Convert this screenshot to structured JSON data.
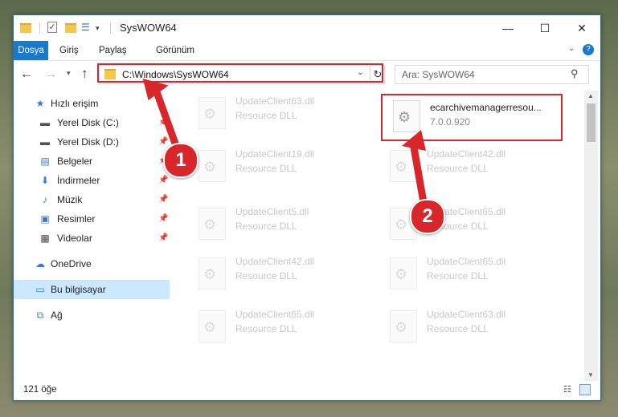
{
  "window": {
    "title": "SysWOW64",
    "controls": {
      "minimize": "—",
      "maximize": "☐",
      "close": "✕"
    }
  },
  "ribbon": {
    "tabs": [
      {
        "label": "Dosya"
      },
      {
        "label": "Giriş"
      },
      {
        "label": "Paylaş"
      },
      {
        "label": "Görünüm"
      }
    ],
    "help": "?"
  },
  "nav": {
    "address": "C:\\Windows\\SysWOW64",
    "search_placeholder": "Ara: SysWOW64"
  },
  "sidebar": {
    "items": [
      {
        "label": "Hızlı erişim",
        "icon": "star-icon",
        "pinned": false
      },
      {
        "label": "Yerel Disk (C:)",
        "icon": "disk-icon",
        "pinned": true
      },
      {
        "label": "Yerel Disk (D:)",
        "icon": "disk-icon",
        "pinned": true
      },
      {
        "label": "Belgeler",
        "icon": "documents-icon",
        "pinned": true
      },
      {
        "label": "İndirmeler",
        "icon": "download-icon",
        "pinned": true
      },
      {
        "label": "Müzik",
        "icon": "music-icon",
        "pinned": true
      },
      {
        "label": "Resimler",
        "icon": "pictures-icon",
        "pinned": true
      },
      {
        "label": "Videolar",
        "icon": "video-icon",
        "pinned": true
      },
      {
        "label": "OneDrive",
        "icon": "cloud-icon",
        "pinned": false
      },
      {
        "label": "Bu bilgisayar",
        "icon": "computer-icon",
        "pinned": false,
        "selected": true
      },
      {
        "label": "Ağ",
        "icon": "network-icon",
        "pinned": false
      }
    ]
  },
  "files": [
    {
      "name": "UpdateClient63.dll",
      "sub": "Resource DLL",
      "faded": true
    },
    {
      "name": "ecarchivemanagerresou...",
      "sub": "7.0.0.920",
      "faded": false,
      "highlighted": true
    },
    {
      "name": "UpdateClient19.dll",
      "sub": "Resource DLL",
      "faded": true
    },
    {
      "name": "UpdateClient42.dll",
      "sub": "Resource DLL",
      "faded": true
    },
    {
      "name": "UpdateClient5.dll",
      "sub": "Resource DLL",
      "faded": true
    },
    {
      "name": "UpdateClient65.dll",
      "sub": "Resource DLL",
      "faded": true
    },
    {
      "name": "UpdateClient42.dll",
      "sub": "Resource DLL",
      "faded": true
    },
    {
      "name": "UpdateClient65.dll",
      "sub": "Resource DLL",
      "faded": true
    },
    {
      "name": "UpdateClient65.dll",
      "sub": "Resource DLL",
      "faded": true
    },
    {
      "name": "UpdateClient63.dll",
      "sub": "Resource DLL",
      "faded": true
    }
  ],
  "status": {
    "count": "121 öğe"
  },
  "annotations": {
    "step1": "1",
    "step2": "2",
    "color": "#d9262b"
  }
}
